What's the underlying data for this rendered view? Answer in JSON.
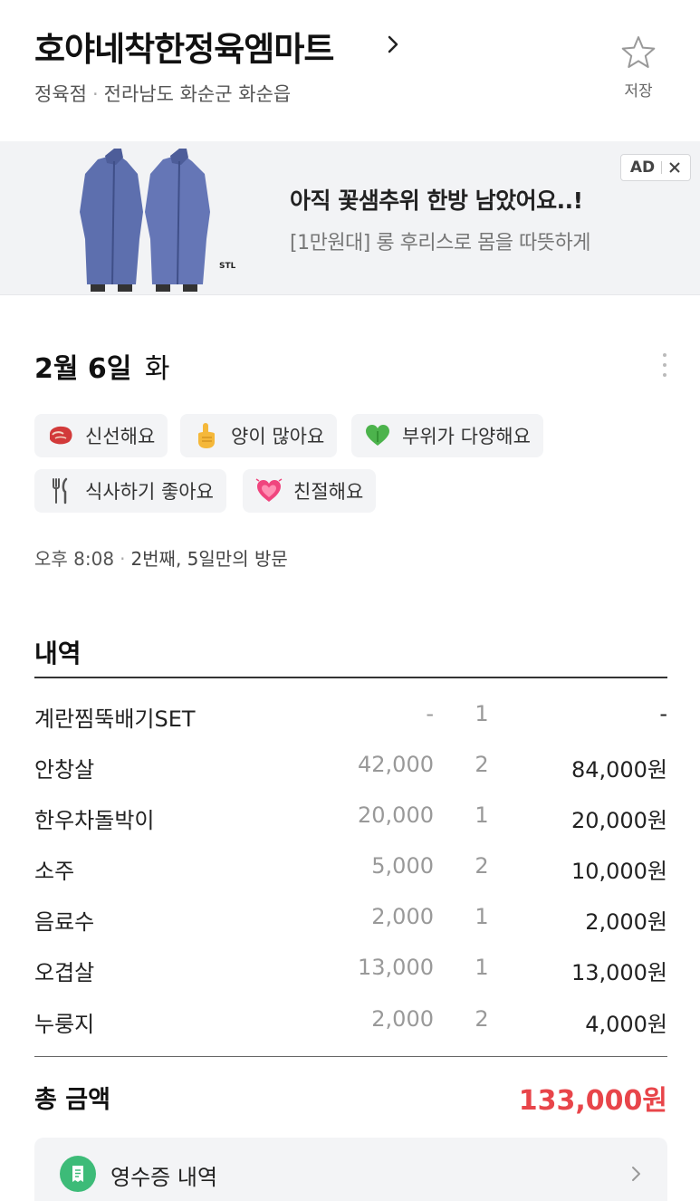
{
  "header": {
    "store_name": "호야네착한정육엠마트",
    "category": "정육점",
    "location": "전라남도 화순군 화순읍",
    "save_label": "저장"
  },
  "ad": {
    "badge": "AD",
    "title": "아직 꽃샘추위 한방 남았어요..!",
    "description": "[1만원대] 롱 후리스로 몸을 따뜻하게",
    "brand_mark": "STL"
  },
  "visit": {
    "date": "2월 6일",
    "day_of_week": "화",
    "time": "오후 8:08",
    "visit_count": "2번째, 5일만의 방문"
  },
  "tags": [
    {
      "label": "신선해요",
      "icon": "meat-icon"
    },
    {
      "label": "양이 많아요",
      "icon": "pointing-finger-icon"
    },
    {
      "label": "부위가 다양해요",
      "icon": "green-heart-icon"
    },
    {
      "label": "식사하기 좋아요",
      "icon": "fork-knife-icon"
    },
    {
      "label": "친절해요",
      "icon": "heart-icon"
    }
  ],
  "details": {
    "title": "내역",
    "items": [
      {
        "name": "계란찜뚝배기SET",
        "price": "-",
        "qty": "1",
        "sum": "-"
      },
      {
        "name": "안창살",
        "price": "42,000",
        "qty": "2",
        "sum": "84,000원"
      },
      {
        "name": "한우차돌박이",
        "price": "20,000",
        "qty": "1",
        "sum": "20,000원"
      },
      {
        "name": "소주",
        "price": "5,000",
        "qty": "2",
        "sum": "10,000원"
      },
      {
        "name": "음료수",
        "price": "2,000",
        "qty": "1",
        "sum": "2,000원"
      },
      {
        "name": "오겹살",
        "price": "13,000",
        "qty": "1",
        "sum": "13,000원"
      },
      {
        "name": "누룽지",
        "price": "2,000",
        "qty": "2",
        "sum": "4,000원"
      }
    ],
    "total_label": "총 금액",
    "total_value": "133,000원"
  },
  "receipt": {
    "label": "영수증 내역"
  },
  "colors": {
    "accent_red": "#e8454a",
    "receipt_green": "#3dbb78",
    "ad_bg": "#f2f3f5"
  }
}
